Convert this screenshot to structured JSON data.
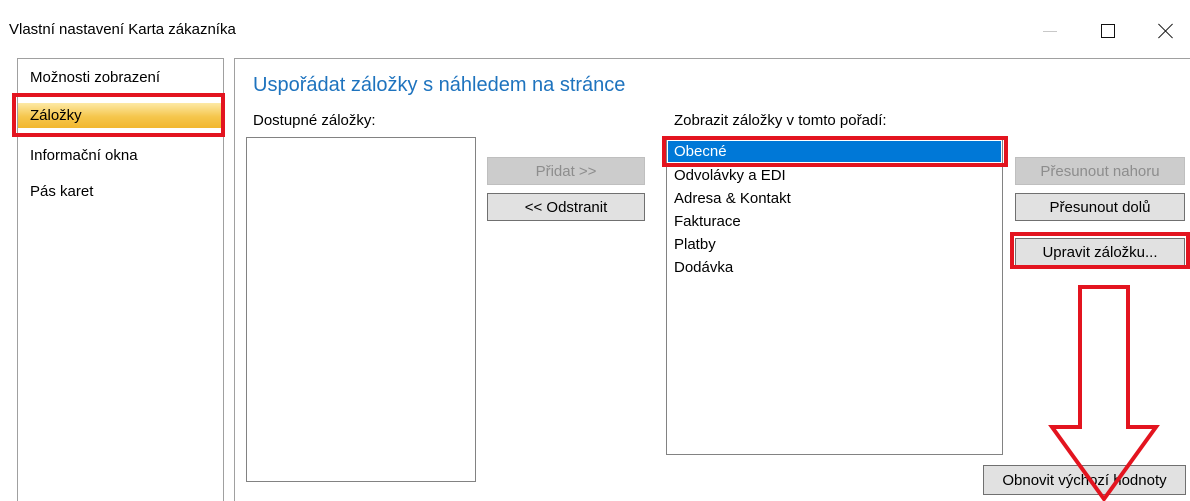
{
  "window": {
    "title": "Vlastní nastavení Karta zákazníka",
    "controls": {
      "minimize": "minimize-icon",
      "maximize": "maximize-icon",
      "close": "close-icon"
    }
  },
  "sidebar": {
    "items": [
      {
        "label": "Možnosti zobrazení"
      },
      {
        "label": "Záložky",
        "selected": true
      },
      {
        "label": "Informační okna"
      },
      {
        "label": "Pás karet"
      }
    ]
  },
  "main": {
    "heading": "Uspořádat záložky s náhledem na stránce",
    "available_label": "Dostupné záložky:",
    "available_items": [],
    "order_label": "Zobrazit záložky v tomto pořadí:",
    "order_items": [
      {
        "label": "Obecné",
        "selected": true
      },
      {
        "label": "Odvolávky a EDI"
      },
      {
        "label": "Adresa & Kontakt"
      },
      {
        "label": "Fakturace"
      },
      {
        "label": "Platby"
      },
      {
        "label": "Dodávka"
      }
    ],
    "add_button": "Přidat >>",
    "remove_button": "<< Odstranit",
    "move_up_button": "Přesunout nahoru",
    "move_down_button": "Přesunout dolů",
    "edit_button": "Upravit záložku...",
    "reset_button": "Obnovit výchozí hodnoty"
  },
  "colors": {
    "highlight": "#e3141f",
    "heading": "#1e73be",
    "selection": "#0078d7",
    "nav_selection": "#f5c64c"
  }
}
